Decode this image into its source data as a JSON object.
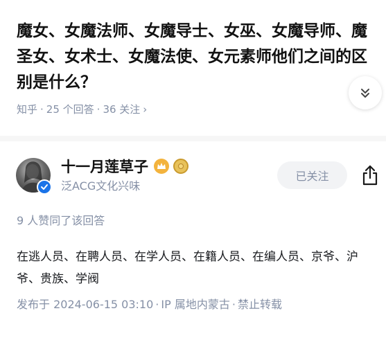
{
  "question": {
    "title": "魔女、女魔法师、女魔导士、女巫、女魔导师、魔圣女、女术士、女魔法使、女元素师他们之间的区别是什么？",
    "source": "知乎",
    "separator": "·",
    "answers_count": "25 个回答",
    "followers_count": "36 关注",
    "chevron": "›"
  },
  "author": {
    "name": "十一月莲草子",
    "tag": "泛ACG文化兴味",
    "follow_label": "已关注"
  },
  "answer": {
    "upvote_summary": "9 人赞同了该回答",
    "content": "在逃人员、在聘人员、在学人员、在籍人员、在编人员、京爷、沪爷、贵族、学阀",
    "published": "发布于 2024-06-15 03:10",
    "ip_location": "IP 属地内蒙古",
    "copyright": "禁止转载",
    "separator": "·"
  },
  "colors": {
    "meta_gray": "#8590a6",
    "verified_blue": "#1a73e8",
    "level_gold": "#f3b33d",
    "follow_bg": "#f2f3f5"
  },
  "icons": {
    "expand": "chevron-double-down-icon",
    "verified": "verified-check-icon",
    "level": "crown-level-icon",
    "medal": "medal-icon",
    "share": "share-icon"
  }
}
